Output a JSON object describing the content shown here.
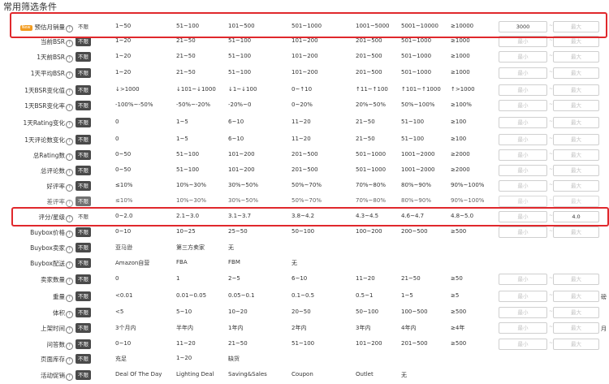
{
  "title": "常用筛选条件",
  "badge_new": "New",
  "placeholders": {
    "min": "最小",
    "max": "最大"
  },
  "rows": [
    {
      "label": "预估月销量",
      "new": true,
      "help": true,
      "pill": "不限",
      "pill_active": false,
      "options": [
        "1~50",
        "51~100",
        "101~500",
        "501~1000",
        "1001~5000",
        "5001~10000",
        "≥10000"
      ],
      "min_value": "3000",
      "max_value": ""
    },
    {
      "label": "当前BSR",
      "help": true,
      "pill": "不限",
      "options": [
        "1~20",
        "21~50",
        "51~100",
        "101~200",
        "201~500",
        "501~1000",
        "≥1000"
      ]
    },
    {
      "label": "1天前BSR",
      "help": true,
      "pill": "不限",
      "options": [
        "1~20",
        "21~50",
        "51~100",
        "101~200",
        "201~500",
        "501~1000",
        "≥1000"
      ]
    },
    {
      "label": "1天平均BSR",
      "help": true,
      "pill": "不限",
      "options": [
        "1~20",
        "21~50",
        "51~100",
        "101~200",
        "201~500",
        "501~1000",
        "≥1000"
      ]
    },
    {
      "label": "1天BSR变化值",
      "help": true,
      "pill": "不限",
      "options": [
        "↓>1000",
        "↓101~↓1000",
        "↓1~↓100",
        "0~↑10",
        "↑11~↑100",
        "↑101~↑1000",
        "↑>1000"
      ]
    },
    {
      "label": "1天BSR变化率",
      "help": true,
      "pill": "不限",
      "options": [
        "-100%~-50%",
        "-50%~-20%",
        "-20%~0",
        "0~20%",
        "20%~50%",
        "50%~100%",
        "≥100%"
      ]
    },
    {
      "label": "1天Rating变化",
      "help": true,
      "pill": "不限",
      "options": [
        "0",
        "1~5",
        "6~10",
        "11~20",
        "21~50",
        "51~100",
        "≥100"
      ]
    },
    {
      "label": "1天评论数变化",
      "help": true,
      "pill": "不限",
      "options": [
        "0",
        "1~5",
        "6~10",
        "11~20",
        "21~50",
        "51~100",
        "≥100"
      ]
    },
    {
      "label": "总Rating数",
      "help": true,
      "pill": "不限",
      "options": [
        "0~50",
        "51~100",
        "101~200",
        "201~500",
        "501~1000",
        "1001~2000",
        "≥2000"
      ]
    },
    {
      "label": "总评论数",
      "help": true,
      "pill": "不限",
      "options": [
        "0~50",
        "51~100",
        "101~200",
        "201~500",
        "501~1000",
        "1001~2000",
        "≥2000"
      ]
    },
    {
      "label": "好评率",
      "help": true,
      "pill": "不限",
      "options": [
        "≤10%",
        "10%~30%",
        "30%~50%",
        "50%~70%",
        "70%~80%",
        "80%~90%",
        "90%~100%"
      ]
    },
    {
      "label": "差评率",
      "help": true,
      "pill": "不限",
      "options": [
        "≤10%",
        "10%~30%",
        "30%~50%",
        "50%~70%",
        "70%~80%",
        "80%~90%",
        "90%~100%"
      ]
    },
    {
      "label": "评分/星级",
      "help": true,
      "pill": "不限",
      "plain": true,
      "options": [
        "0~2.0",
        "2.1~3.0",
        "3.1~3.7",
        "3.8~4.2",
        "4.3~4.5",
        "4.6~4.7",
        "4.8~5.0"
      ],
      "min_value": "",
      "max_value": "4.0"
    },
    {
      "label": "Buybox价格",
      "help": true,
      "pill": "不限",
      "options": [
        "0~10",
        "10~25",
        "25~50",
        "50~100",
        "100~200",
        "200~500",
        "≥500"
      ]
    },
    {
      "label": "Buybox卖家",
      "help": true,
      "pill": "不限",
      "options": [
        "亚马逊",
        "第三方卖家",
        "无"
      ],
      "no_inputs": true
    },
    {
      "label": "Buybox配送",
      "help": true,
      "pill": "不限",
      "options": [
        "Amazon自营",
        "FBA",
        "FBM",
        "无"
      ],
      "no_inputs": true
    },
    {
      "label": "卖家数量",
      "help": true,
      "pill": "不限",
      "options": [
        "0",
        "1",
        "2~5",
        "6~10",
        "11~20",
        "21~50",
        "≥50"
      ]
    },
    {
      "label": "重量",
      "help": true,
      "pill": "不限",
      "options": [
        "<0.01",
        "0.01~0.05",
        "0.05~0.1",
        "0.1~0.5",
        "0.5~1",
        "1~5",
        "≥5"
      ],
      "unit": "磅"
    },
    {
      "label": "体积",
      "help": true,
      "pill": "不限",
      "options": [
        "<5",
        "5~10",
        "10~20",
        "20~50",
        "50~100",
        "100~500",
        "≥500"
      ]
    },
    {
      "label": "上架时间",
      "help": true,
      "pill": "不限",
      "options": [
        "3个月内",
        "半年内",
        "1年内",
        "2年内",
        "3年内",
        "4年内",
        "≥4年"
      ],
      "unit": "月"
    },
    {
      "label": "问答数",
      "help": true,
      "pill": "不限",
      "options": [
        "0~10",
        "11~20",
        "21~50",
        "51~100",
        "101~200",
        "201~500",
        "≥500"
      ]
    },
    {
      "label": "页面库存",
      "help": true,
      "pill": "不限",
      "options": [
        "充足",
        "1~20",
        "缺货"
      ],
      "no_inputs": true
    },
    {
      "label": "活动促销",
      "help": true,
      "pill": "不限",
      "options": [
        "Deal Of The Day",
        "Lighting Deal",
        "Saving&Sales",
        "Coupon",
        "Outlet",
        "无"
      ],
      "no_inputs": true
    }
  ],
  "colors": {
    "highlight": "#e0282c",
    "pill_bg": "#4a4a4a",
    "new_badge": "#f29b1e"
  }
}
